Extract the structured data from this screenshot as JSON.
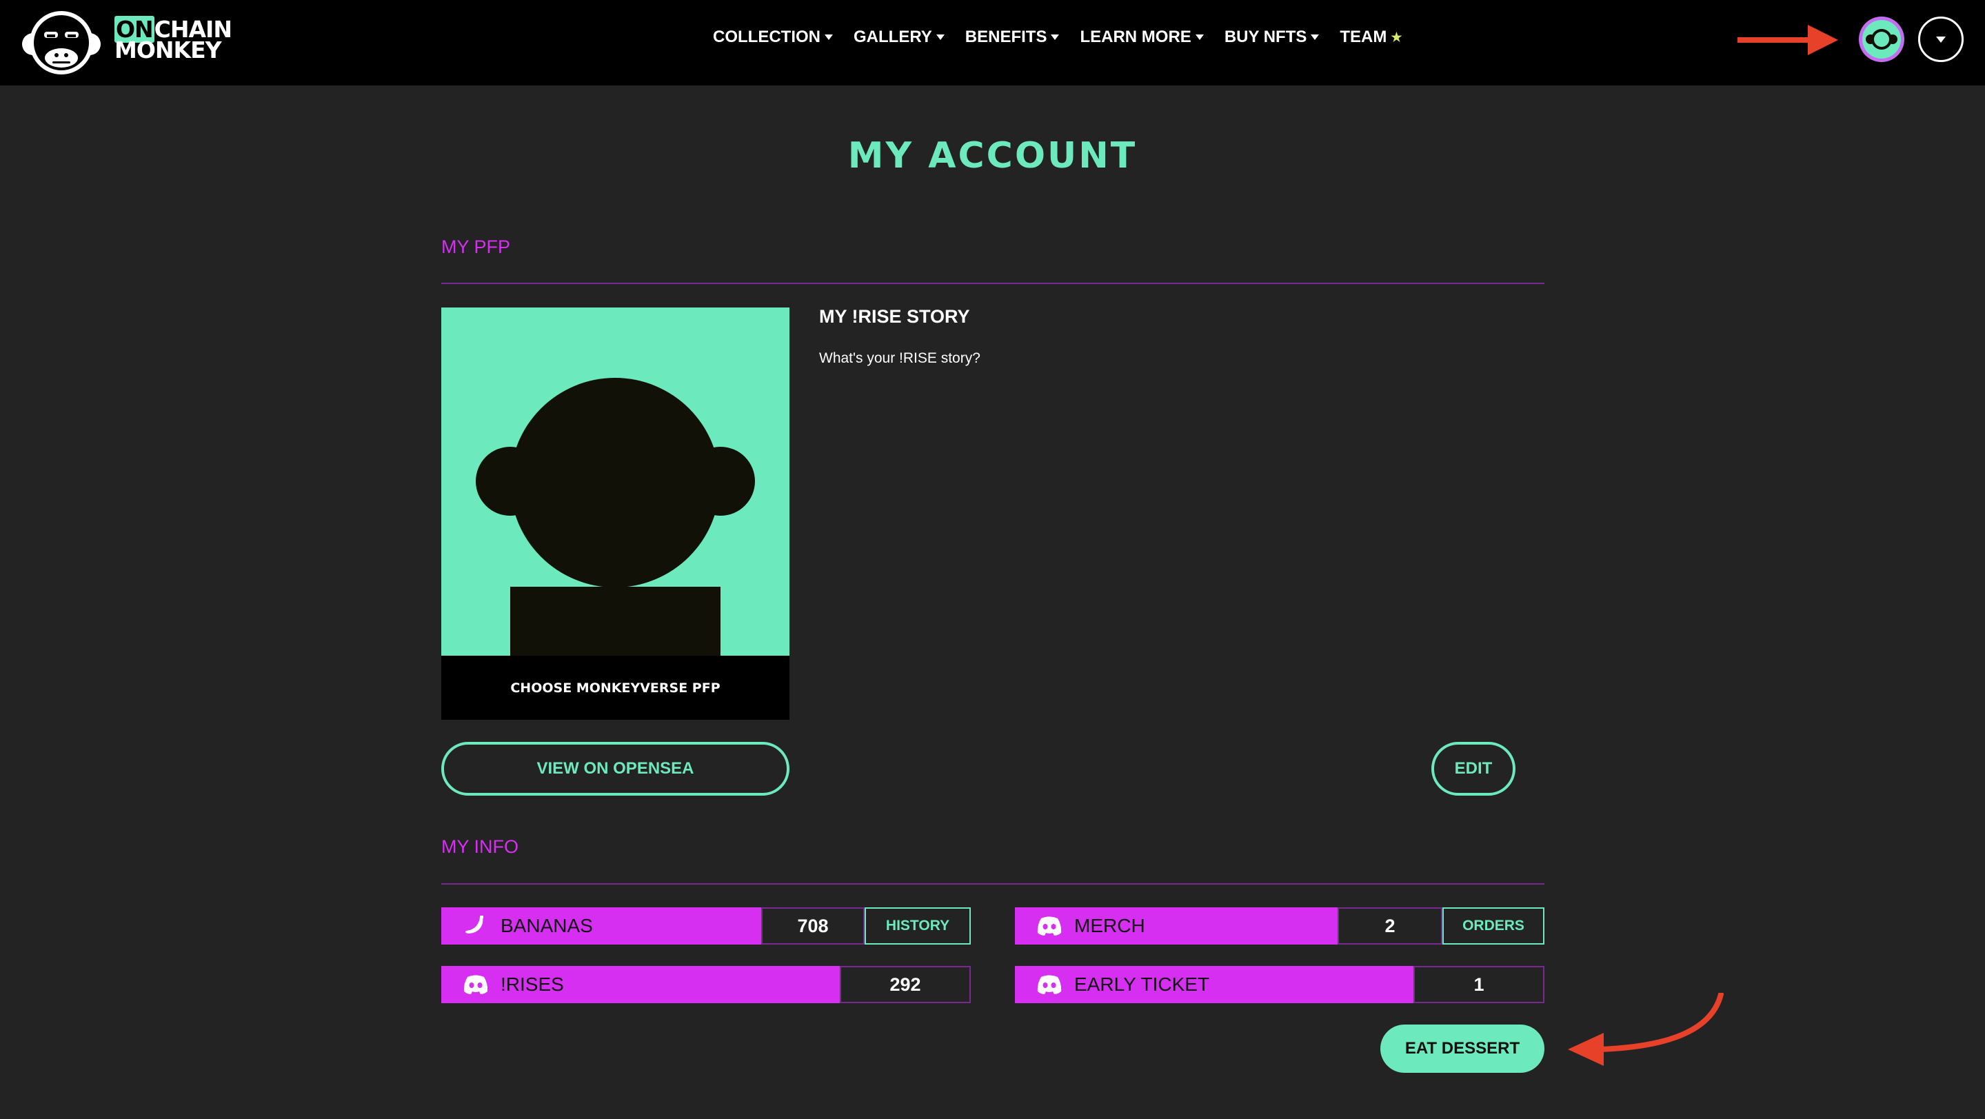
{
  "header": {
    "logo": {
      "line1_highlight": "ON",
      "line1_rest": "CHAIN",
      "line2": "MONKEY"
    },
    "nav": [
      {
        "label": "COLLECTION",
        "has_caret": true
      },
      {
        "label": "GALLERY",
        "has_caret": true
      },
      {
        "label": "BENEFITS",
        "has_caret": true
      },
      {
        "label": "LEARN MORE",
        "has_caret": true
      },
      {
        "label": "BUY NFTS",
        "has_caret": true
      },
      {
        "label": "TEAM",
        "has_caret": false,
        "suffix": "★"
      }
    ],
    "icons": {
      "avatar": "avatar-icon",
      "dropdown": "chevron-down-icon"
    }
  },
  "page": {
    "title": "MY ACCOUNT"
  },
  "pfp_section": {
    "label": "MY PFP",
    "caption": "CHOOSE MONKEYVERSE PFP",
    "story_title": "MY !RISE STORY",
    "story_text": "What's your !RISE story?",
    "view_button": "VIEW ON OPENSEA",
    "edit_button": "EDIT"
  },
  "info_section": {
    "label": "MY INFO",
    "bananas": {
      "label": "BANANAS",
      "value": "708",
      "action": "HISTORY",
      "icon": "banana-icon"
    },
    "merch": {
      "label": "MERCH",
      "value": "2",
      "action": "ORDERS",
      "icon": "discord-icon"
    },
    "rises": {
      "label": "!RISES",
      "value": "292",
      "icon": "discord-icon"
    },
    "early_ticket": {
      "label": "EARLY TICKET",
      "value": "1",
      "icon": "discord-icon"
    },
    "dessert_button": "EAT DESSERT"
  },
  "colors": {
    "background": "#232323",
    "header": "#000000",
    "accent_mint": "#6ce9bd",
    "accent_magenta": "#d62ff2",
    "annotation_red": "#e8412a"
  }
}
